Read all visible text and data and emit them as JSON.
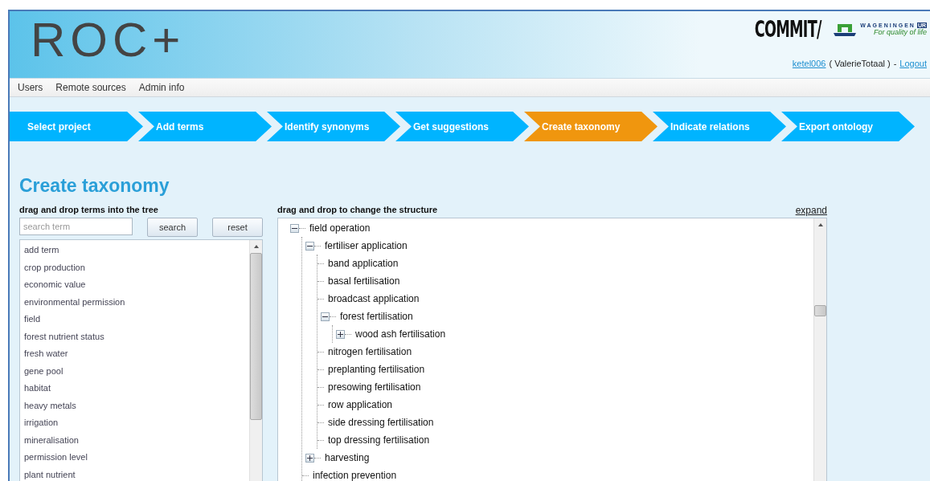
{
  "header": {
    "logo": "ROC+",
    "partner_logo": "COMMIT/",
    "brand": "WAGENINGEN",
    "brand_suffix": "UR",
    "brand_tagline": "For quality of life",
    "user_link": "ketel006",
    "user_name": "( ValerieTotaal )",
    "separator": "-",
    "logout": "Logout"
  },
  "menu": [
    "Users",
    "Remote sources",
    "Admin info"
  ],
  "steps": [
    {
      "label": "Select project",
      "selected": false
    },
    {
      "label": "Add terms",
      "selected": false
    },
    {
      "label": "Identify synonyms",
      "selected": false
    },
    {
      "label": "Get suggestions",
      "selected": false
    },
    {
      "label": "Create taxonomy",
      "selected": true
    },
    {
      "label": "Indicate relations",
      "selected": false
    },
    {
      "label": "Export ontology",
      "selected": false
    }
  ],
  "page_title": "Create taxonomy",
  "terms_panel": {
    "label": "drag and drop terms into the tree",
    "search": {
      "placeholder": "search term"
    },
    "buttons": [
      "search",
      "reset"
    ],
    "terms": [
      "add term",
      "crop production",
      "economic value",
      "environmental permission",
      "field",
      "forest nutrient status",
      "fresh water",
      "gene pool",
      "habitat",
      "heavy metals",
      "irrigation",
      "mineralisation",
      "permission level",
      "plant nutrient"
    ]
  },
  "tree_panel": {
    "label": "drag and drop to change the structure",
    "expand_link": "expand",
    "tree": [
      {
        "label": "field operation",
        "expanded": true,
        "children": [
          {
            "label": "fertiliser application",
            "expanded": true,
            "children": [
              {
                "label": "band application"
              },
              {
                "label": "basal fertilisation"
              },
              {
                "label": "broadcast application"
              },
              {
                "label": "forest fertilisation",
                "expanded": true,
                "children": [
                  {
                    "label": "wood ash fertilisation",
                    "expanded": false
                  }
                ]
              },
              {
                "label": "nitrogen fertilisation"
              },
              {
                "label": "preplanting fertilisation"
              },
              {
                "label": "presowing fertilisation"
              },
              {
                "label": "row application"
              },
              {
                "label": "side dressing fertilisation"
              },
              {
                "label": "top dressing fertilisation"
              }
            ]
          },
          {
            "label": "harvesting",
            "expanded": false
          },
          {
            "label": "infection prevention"
          }
        ]
      }
    ]
  }
}
